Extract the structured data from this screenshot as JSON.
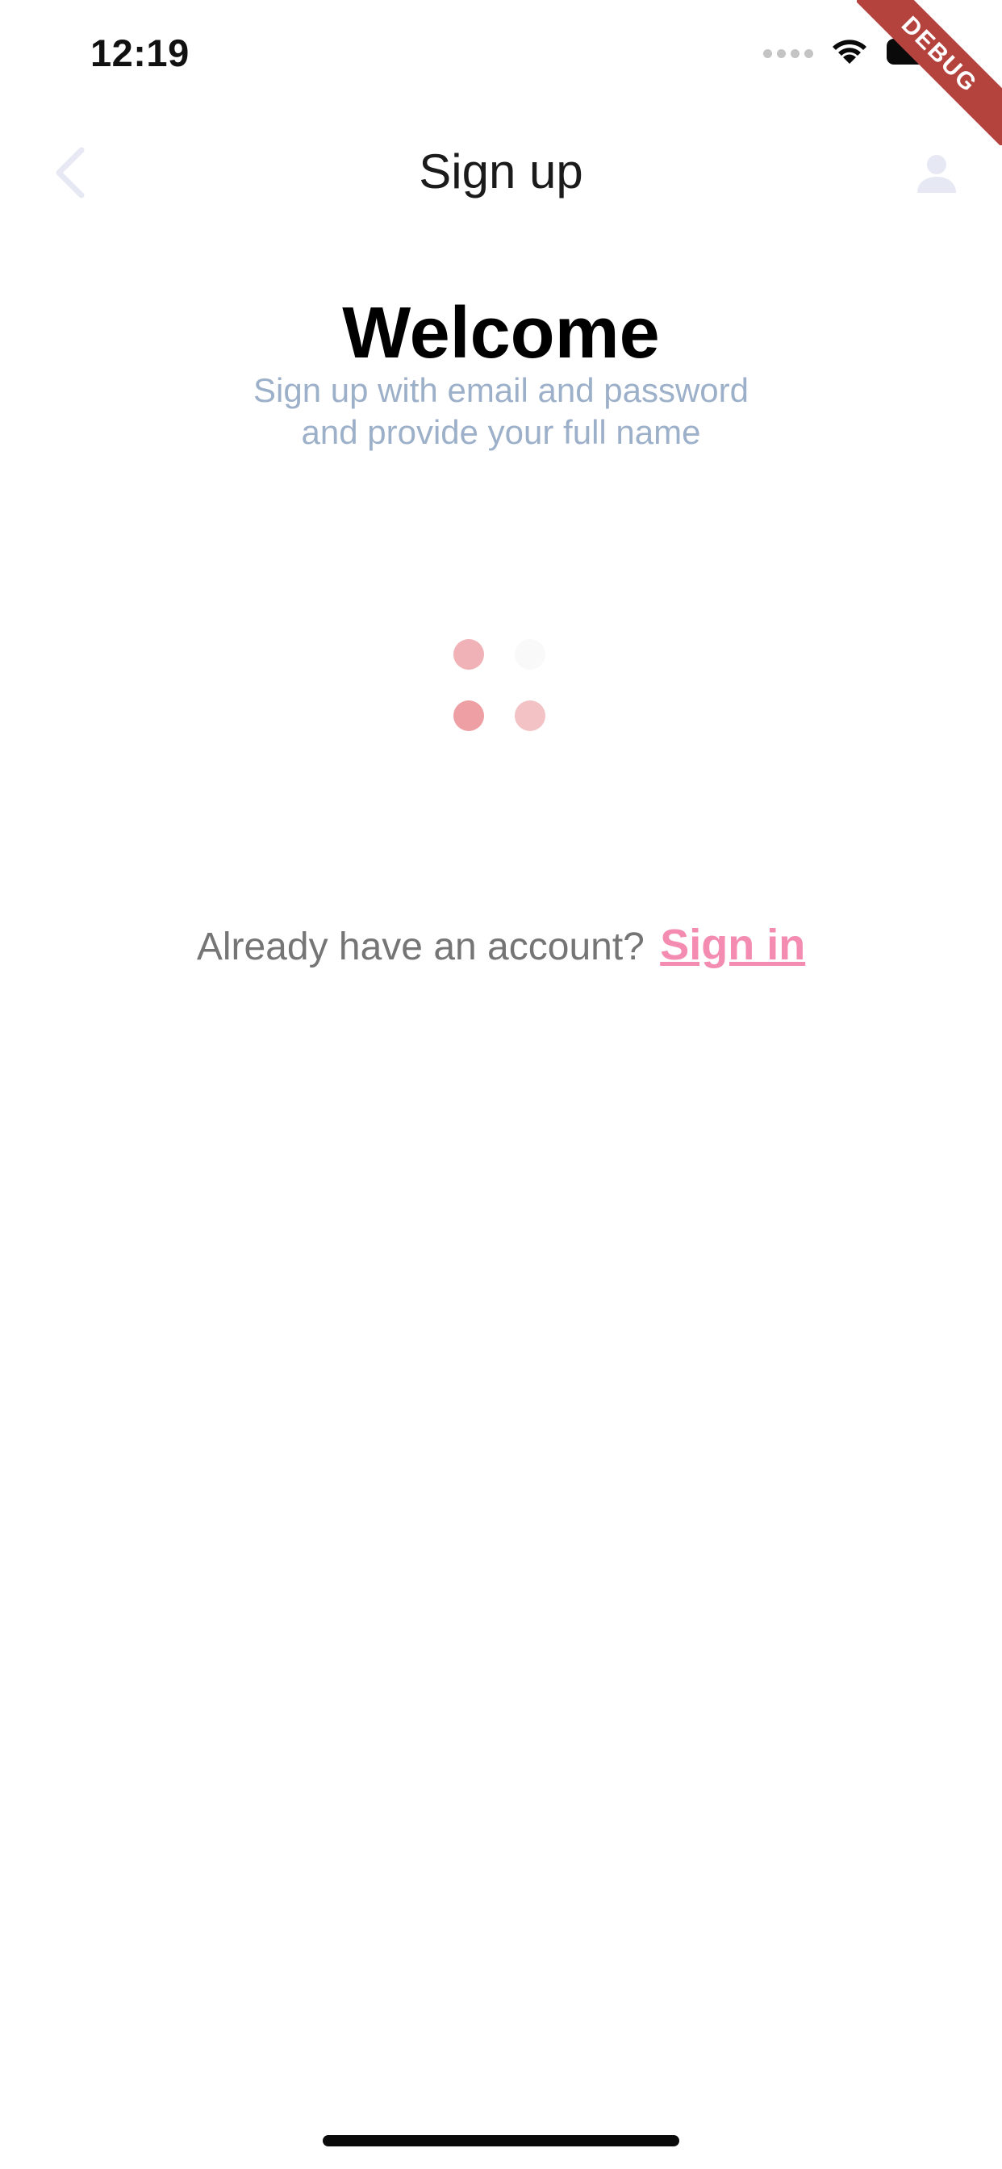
{
  "status_bar": {
    "time": "12:19",
    "icons": [
      "signal-dots-icon",
      "wifi-icon",
      "battery-icon"
    ]
  },
  "debug_banner": {
    "label": "DEBUG",
    "color": "#b4433e"
  },
  "app_bar": {
    "title": "Sign up",
    "back_icon": "chevron-left-icon",
    "profile_icon": "person-icon",
    "icon_color": "#e6e9f3"
  },
  "welcome": {
    "title": "Welcome",
    "subtitle_line1": "Sign up with email and password",
    "subtitle_line2": "and provide your full name",
    "subtitle_color": "#9db0c9"
  },
  "loader": {
    "icon": "loading-dots-icon",
    "colors": [
      "#f0b2b6",
      "#f9f9f9",
      "#ee9fa4",
      "#f3c2c4"
    ]
  },
  "signin_prompt": {
    "text": "Already have an account?",
    "link_label": "Sign in",
    "link_color": "#f38cb0"
  }
}
